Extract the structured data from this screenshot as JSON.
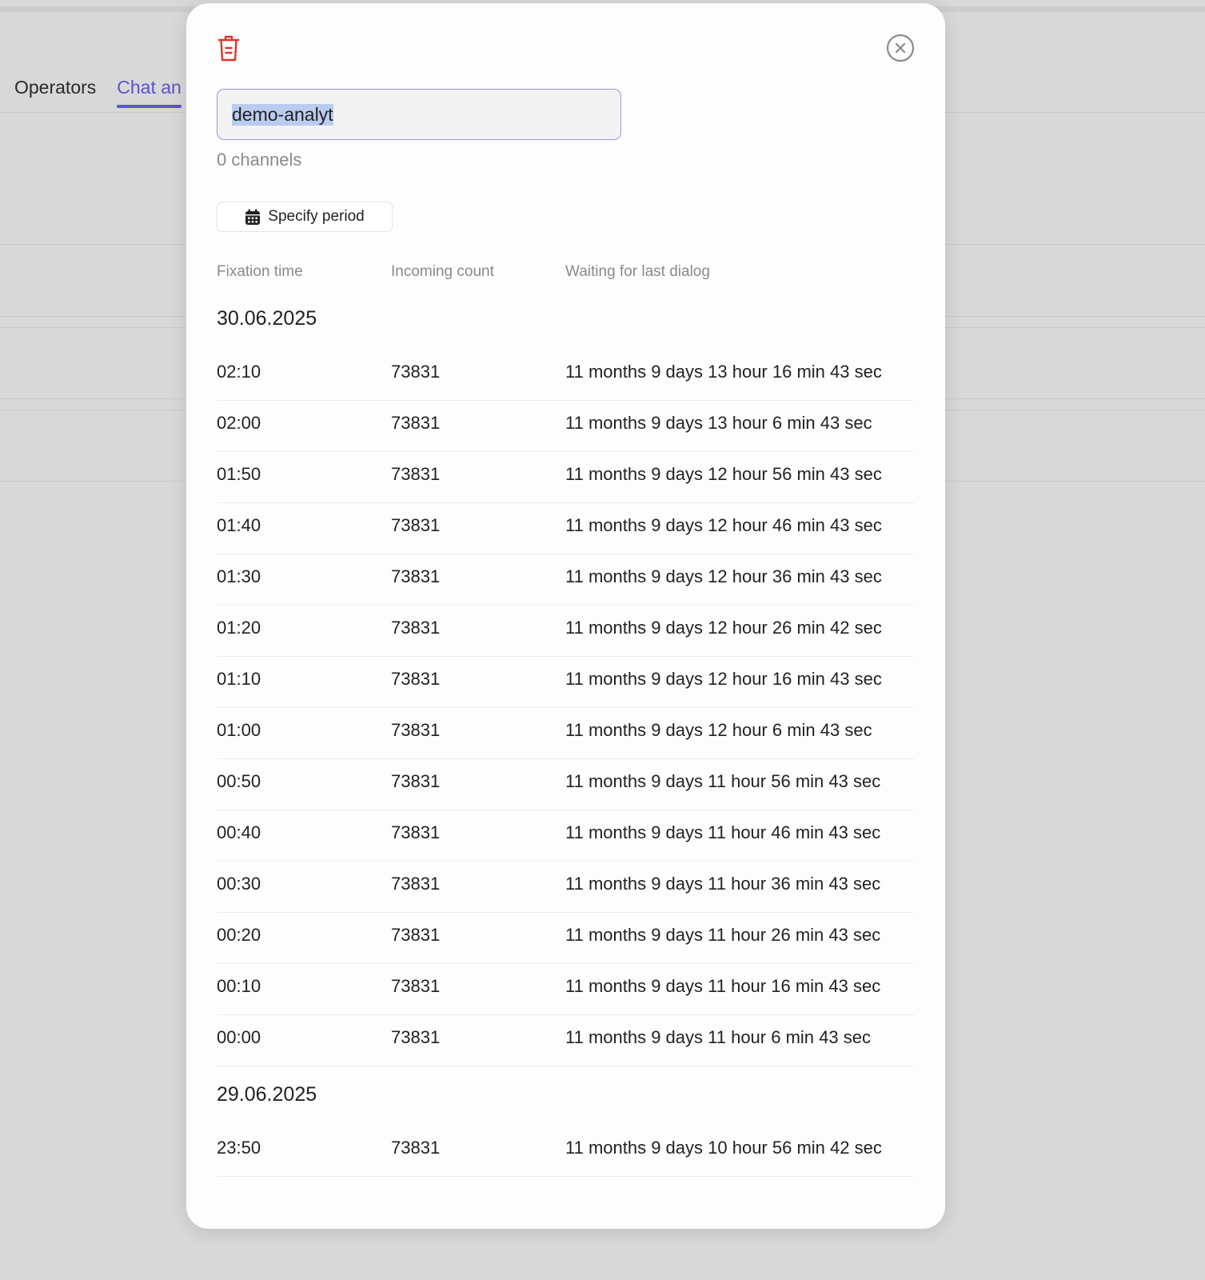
{
  "background": {
    "tabs": [
      {
        "label": "Operators"
      },
      {
        "label": "Chat an"
      }
    ]
  },
  "modal": {
    "name_value": "demo-analyt",
    "channels_text": "0 channels",
    "period_button_label": "Specify period",
    "columns": [
      "Fixation time",
      "Incoming count",
      "Waiting for last dialog"
    ],
    "groups": [
      {
        "date": "30.06.2025",
        "rows": [
          {
            "time": "02:10",
            "count": "73831",
            "waiting": "11 months 9 days 13 hour 16 min 43 sec"
          },
          {
            "time": "02:00",
            "count": "73831",
            "waiting": "11 months 9 days 13 hour 6 min 43 sec"
          },
          {
            "time": "01:50",
            "count": "73831",
            "waiting": "11 months 9 days 12 hour 56 min 43 sec"
          },
          {
            "time": "01:40",
            "count": "73831",
            "waiting": "11 months 9 days 12 hour 46 min 43 sec"
          },
          {
            "time": "01:30",
            "count": "73831",
            "waiting": "11 months 9 days 12 hour 36 min 43 sec"
          },
          {
            "time": "01:20",
            "count": "73831",
            "waiting": "11 months 9 days 12 hour 26 min 42 sec"
          },
          {
            "time": "01:10",
            "count": "73831",
            "waiting": "11 months 9 days 12 hour 16 min 43 sec"
          },
          {
            "time": "01:00",
            "count": "73831",
            "waiting": "11 months 9 days 12 hour 6 min 43 sec"
          },
          {
            "time": "00:50",
            "count": "73831",
            "waiting": "11 months 9 days 11 hour 56 min 43 sec"
          },
          {
            "time": "00:40",
            "count": "73831",
            "waiting": "11 months 9 days 11 hour 46 min 43 sec"
          },
          {
            "time": "00:30",
            "count": "73831",
            "waiting": "11 months 9 days 11 hour 36 min 43 sec"
          },
          {
            "time": "00:20",
            "count": "73831",
            "waiting": "11 months 9 days 11 hour 26 min 43 sec"
          },
          {
            "time": "00:10",
            "count": "73831",
            "waiting": "11 months 9 days 11 hour 16 min 43 sec"
          },
          {
            "time": "00:00",
            "count": "73831",
            "waiting": "11 months 9 days 11 hour 6 min 43 sec"
          }
        ]
      },
      {
        "date": "29.06.2025",
        "rows": [
          {
            "time": "23:50",
            "count": "73831",
            "waiting": "11 months 9 days 10 hour 56 min 42 sec"
          }
        ]
      }
    ],
    "icons": {
      "delete": "trash-icon",
      "close": "close-circle-icon",
      "calendar": "calendar-icon"
    },
    "colors": {
      "accent": "#5b55c9",
      "danger": "#e0352b",
      "selection": "#b9ccf0"
    }
  }
}
